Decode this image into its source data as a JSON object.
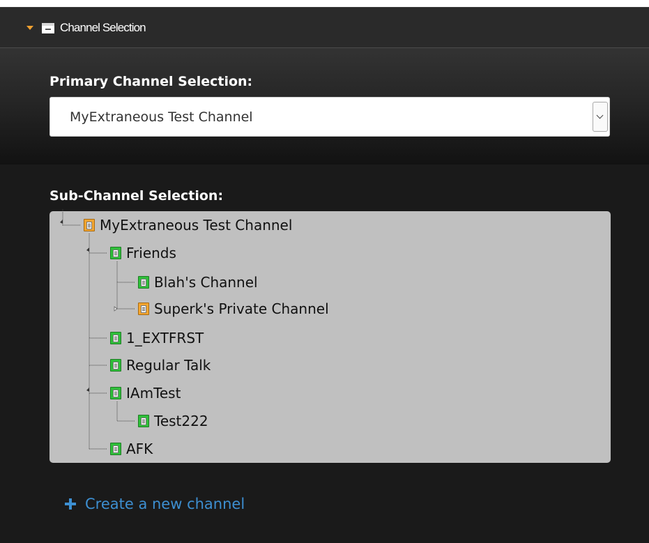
{
  "panel": {
    "title": "Channel Selection",
    "expanded": true,
    "icons": {
      "collapse": "caret-down-icon",
      "panel": "window-icon"
    }
  },
  "primary": {
    "label": "Primary Channel Selection:",
    "selected": "MyExtraneous Test Channel"
  },
  "sub": {
    "label": "Sub-Channel Selection:",
    "tree": [
      {
        "label": "MyExtraneous Test Channel",
        "icon": "orange"
      },
      {
        "label": "Friends",
        "icon": "green"
      },
      {
        "label": "Blah's Channel",
        "icon": "green"
      },
      {
        "label": "Superk's Private Channel",
        "icon": "orange"
      },
      {
        "label": "1_EXTFRST",
        "icon": "green"
      },
      {
        "label": "Regular Talk",
        "icon": "green"
      },
      {
        "label": "IAmTest",
        "icon": "green"
      },
      {
        "label": "Test222",
        "icon": "green"
      },
      {
        "label": "AFK",
        "icon": "green"
      }
    ]
  },
  "create": {
    "label": "Create a new channel"
  },
  "colors": {
    "accent_orange": "#f0a030",
    "link_blue": "#3d8fd1",
    "channel_green": "#2fbf3a",
    "channel_orange": "#f2a530"
  }
}
